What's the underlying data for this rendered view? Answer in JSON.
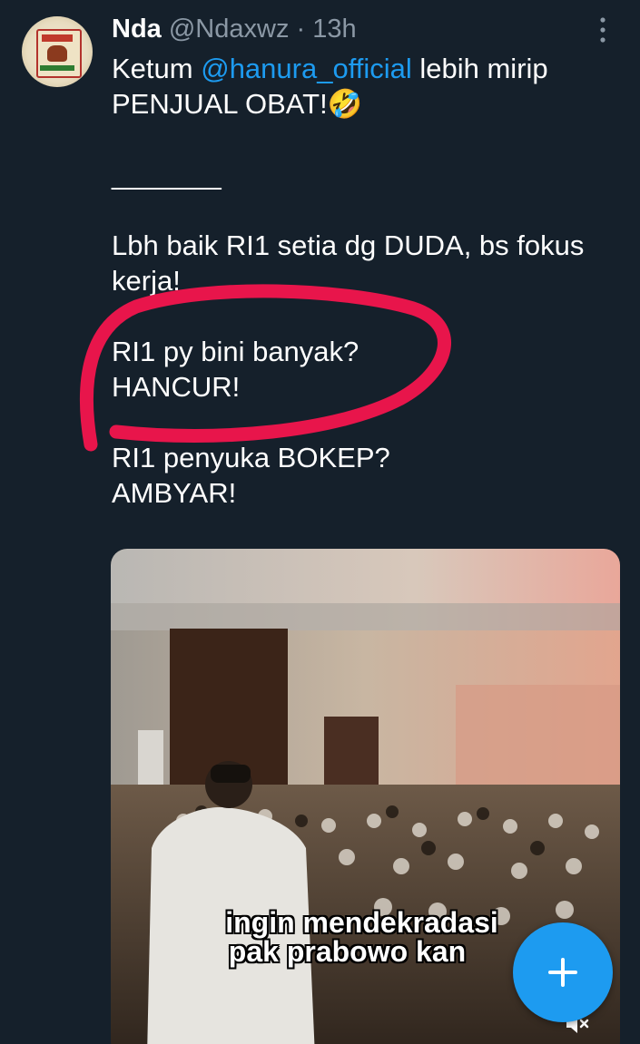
{
  "author": {
    "name": "Nda",
    "handle": "@Ndaxwz",
    "separator": "·",
    "time": "13h"
  },
  "tweet": {
    "line1_prefix": "Ketum ",
    "mention": "@hanura_official",
    "line1_suffix": " lebih mirip",
    "line2": "PENJUAL OBAT!🤣",
    "divider": "_______",
    "para2": "Lbh baik RI1 setia dg DUDA, bs fokus kerja!",
    "para3_line1": "RI1 py bini banyak?",
    "para3_line2": "HANCUR!",
    "para4_line1": "RI1 penyuka BOKEP?",
    "para4_line2": "AMBYAR!"
  },
  "video": {
    "caption_line1": "ingin mendekradasi",
    "caption_line2": "pak prabowo kan"
  },
  "icons": {
    "more": "more-vertical-icon",
    "mute": "volume-mute-icon",
    "compose": "plus-icon"
  },
  "colors": {
    "background": "#15202b",
    "accent": "#1d9bf0",
    "secondary_text": "#8b98a5",
    "annotation": "#e8154b"
  }
}
